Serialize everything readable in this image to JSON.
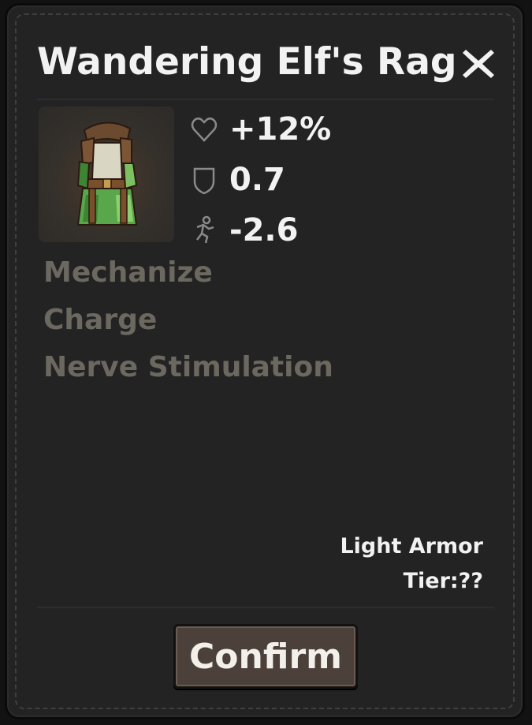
{
  "item": {
    "name": "Wandering Elf's Rag",
    "image_icon": "elf-rag-armor-icon"
  },
  "stats": [
    {
      "icon": "heart-icon",
      "value": "+12%"
    },
    {
      "icon": "shield-icon",
      "value": "0.7"
    },
    {
      "icon": "running-man-icon",
      "value": "-2.6"
    }
  ],
  "abilities": [
    "Mechanize",
    "Charge",
    "Nerve Stimulation"
  ],
  "meta": {
    "type": "Light Armor",
    "tier": "Tier:??"
  },
  "actions": {
    "confirm_label": "Confirm",
    "close_icon": "close-icon"
  },
  "colors": {
    "panel": "#232323",
    "text": "#f2f2f2",
    "muted": "#6b6860",
    "button": "#4c413a"
  }
}
